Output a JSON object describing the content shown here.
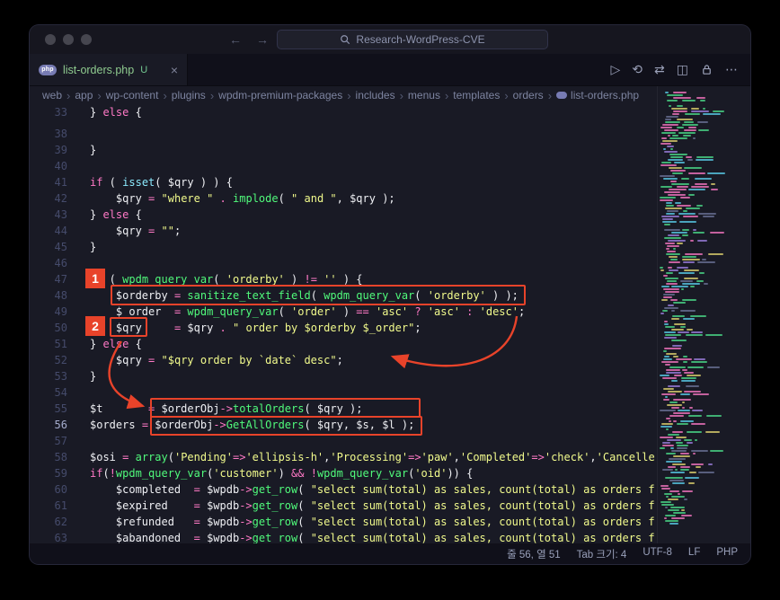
{
  "colors": {
    "accent_red": "#e8432a",
    "php_badge": "#777bb3",
    "keyword": "#ff79c6",
    "function": "#50fa7b",
    "string": "#f1fa8c",
    "builtin": "#8be9fd"
  },
  "title_bar": {
    "search_text": "Research-WordPress-CVE",
    "back_arrow": "←",
    "forward_arrow": "→"
  },
  "icons": {
    "run": "▷",
    "history": "⟲",
    "changes": "⇄",
    "split_editor": "◫",
    "more": "⋯"
  },
  "tab": {
    "file_name": "list-orders.php",
    "git_status": "U",
    "close_glyph": "×",
    "php_icon_label": "php"
  },
  "breadcrumb": {
    "separator": "›",
    "items": [
      "web",
      "app",
      "wp-content",
      "plugins",
      "wpdm-premium-packages",
      "includes",
      "menus",
      "templates",
      "orders",
      "list-orders.php"
    ]
  },
  "annotations": {
    "badge1": "1",
    "badge2": "2"
  },
  "editor": {
    "active_line": 56,
    "fold_gap_after_line": 33,
    "lines": [
      {
        "n": 33,
        "t": [
          [
            "} ",
            "fg"
          ],
          [
            "else",
            "kw"
          ],
          [
            " {",
            "fg"
          ]
        ]
      },
      {
        "n": 38,
        "t": []
      },
      {
        "n": 39,
        "t": [
          [
            "}",
            "fg"
          ]
        ]
      },
      {
        "n": 40,
        "t": []
      },
      {
        "n": 41,
        "t": [
          [
            "if",
            "kw"
          ],
          [
            " ( ",
            "fg"
          ],
          [
            "isset",
            "bi"
          ],
          [
            "( ",
            "fg"
          ],
          [
            "$qry",
            "vr"
          ],
          [
            " ) ) {",
            "fg"
          ]
        ]
      },
      {
        "n": 42,
        "t": [
          [
            "    ",
            "fg"
          ],
          [
            "$qry",
            "vr"
          ],
          [
            " ",
            "fg"
          ],
          [
            "=",
            "op"
          ],
          [
            " ",
            "fg"
          ],
          [
            "\"where \"",
            "st"
          ],
          [
            " ",
            "fg"
          ],
          [
            ".",
            "op"
          ],
          [
            " ",
            "fg"
          ],
          [
            "implode",
            "fn"
          ],
          [
            "( ",
            "fg"
          ],
          [
            "\" and \"",
            "st"
          ],
          [
            ", ",
            "fg"
          ],
          [
            "$qry",
            "vr"
          ],
          [
            " );",
            "fg"
          ]
        ]
      },
      {
        "n": 43,
        "t": [
          [
            "} ",
            "fg"
          ],
          [
            "else",
            "kw"
          ],
          [
            " {",
            "fg"
          ]
        ]
      },
      {
        "n": 44,
        "t": [
          [
            "    ",
            "fg"
          ],
          [
            "$qry",
            "vr"
          ],
          [
            " ",
            "fg"
          ],
          [
            "=",
            "op"
          ],
          [
            " ",
            "fg"
          ],
          [
            "\"\"",
            "st"
          ],
          [
            ";",
            "fg"
          ]
        ]
      },
      {
        "n": 45,
        "t": [
          [
            "}",
            "fg"
          ]
        ]
      },
      {
        "n": 46,
        "t": []
      },
      {
        "n": 47,
        "t": [
          [
            "if",
            "kw"
          ],
          [
            " ( ",
            "fg"
          ],
          [
            "wpdm_query_var",
            "fn"
          ],
          [
            "( ",
            "fg"
          ],
          [
            "'orderby'",
            "st"
          ],
          [
            " ) ",
            "fg"
          ],
          [
            "!=",
            "op"
          ],
          [
            " ",
            "fg"
          ],
          [
            "''",
            "st"
          ],
          [
            " ) {",
            "fg"
          ]
        ]
      },
      {
        "n": 48,
        "t": [
          [
            "    ",
            "fg"
          ],
          [
            "$orderby",
            "vr"
          ],
          [
            " ",
            "fg"
          ],
          [
            "=",
            "op"
          ],
          [
            " ",
            "fg"
          ],
          [
            "sanitize_text_field",
            "fn"
          ],
          [
            "( ",
            "fg"
          ],
          [
            "wpdm_query_var",
            "fn"
          ],
          [
            "( ",
            "fg"
          ],
          [
            "'orderby'",
            "st"
          ],
          [
            " ) );",
            "fg"
          ]
        ]
      },
      {
        "n": 49,
        "t": [
          [
            "    ",
            "fg"
          ],
          [
            "$_order",
            "vr"
          ],
          [
            "  ",
            "fg"
          ],
          [
            "=",
            "op"
          ],
          [
            " ",
            "fg"
          ],
          [
            "wpdm_query_var",
            "fn"
          ],
          [
            "( ",
            "fg"
          ],
          [
            "'order'",
            "st"
          ],
          [
            " ) ",
            "fg"
          ],
          [
            "==",
            "op"
          ],
          [
            " ",
            "fg"
          ],
          [
            "'asc'",
            "st"
          ],
          [
            " ",
            "fg"
          ],
          [
            "?",
            "op"
          ],
          [
            " ",
            "fg"
          ],
          [
            "'asc'",
            "st"
          ],
          [
            " ",
            "fg"
          ],
          [
            ":",
            "op"
          ],
          [
            " ",
            "fg"
          ],
          [
            "'desc'",
            "st"
          ],
          [
            ";",
            "fg"
          ]
        ]
      },
      {
        "n": 50,
        "t": [
          [
            "    ",
            "fg"
          ],
          [
            "$qry",
            "vr"
          ],
          [
            "     ",
            "fg"
          ],
          [
            "=",
            "op"
          ],
          [
            " ",
            "fg"
          ],
          [
            "$qry",
            "vr"
          ],
          [
            " ",
            "fg"
          ],
          [
            ".",
            "op"
          ],
          [
            " ",
            "fg"
          ],
          [
            "\" order by $orderby $_order\"",
            "st"
          ],
          [
            ";",
            "fg"
          ]
        ]
      },
      {
        "n": 51,
        "t": [
          [
            "} ",
            "fg"
          ],
          [
            "else",
            "kw"
          ],
          [
            " {",
            "fg"
          ]
        ]
      },
      {
        "n": 52,
        "t": [
          [
            "    ",
            "fg"
          ],
          [
            "$qry",
            "vr"
          ],
          [
            " ",
            "fg"
          ],
          [
            "=",
            "op"
          ],
          [
            " ",
            "fg"
          ],
          [
            "\"$qry order by `date` desc\"",
            "st"
          ],
          [
            ";",
            "fg"
          ]
        ]
      },
      {
        "n": 53,
        "t": [
          [
            "}",
            "fg"
          ]
        ]
      },
      {
        "n": 54,
        "t": []
      },
      {
        "n": 55,
        "t": [
          [
            "$t",
            "vr"
          ],
          [
            "       ",
            "fg"
          ],
          [
            "=",
            "op"
          ],
          [
            " ",
            "fg"
          ],
          [
            "$orderObj",
            "vr"
          ],
          [
            "->",
            "op"
          ],
          [
            "totalOrders",
            "fn"
          ],
          [
            "( ",
            "fg"
          ],
          [
            "$qry",
            "vr"
          ],
          [
            " );",
            "fg"
          ]
        ]
      },
      {
        "n": 56,
        "t": [
          [
            "$orders",
            "vr"
          ],
          [
            " ",
            "fg"
          ],
          [
            "=",
            "op"
          ],
          [
            " ",
            "fg"
          ],
          [
            "$orderObj",
            "vr"
          ],
          [
            "->",
            "op"
          ],
          [
            "GetAllOrders",
            "fn"
          ],
          [
            "( ",
            "fg"
          ],
          [
            "$qry",
            "vr"
          ],
          [
            ", ",
            "fg"
          ],
          [
            "$s",
            "vr"
          ],
          [
            ", ",
            "fg"
          ],
          [
            "$l",
            "vr"
          ],
          [
            " );",
            "fg"
          ]
        ]
      },
      {
        "n": 57,
        "t": []
      },
      {
        "n": 58,
        "t": [
          [
            "$osi",
            "vr"
          ],
          [
            " ",
            "fg"
          ],
          [
            "=",
            "op"
          ],
          [
            " ",
            "fg"
          ],
          [
            "array",
            "fn"
          ],
          [
            "(",
            "fg"
          ],
          [
            "'Pending'",
            "st"
          ],
          [
            "=>",
            "op"
          ],
          [
            "'ellipsis-h'",
            "st"
          ],
          [
            ",",
            "fg"
          ],
          [
            "'Processing'",
            "st"
          ],
          [
            "=>",
            "op"
          ],
          [
            "'paw'",
            "st"
          ],
          [
            ",",
            "fg"
          ],
          [
            "'Completed'",
            "st"
          ],
          [
            "=>",
            "op"
          ],
          [
            "'check'",
            "st"
          ],
          [
            ",",
            "fg"
          ],
          [
            "'Cancelle",
            "st"
          ]
        ]
      },
      {
        "n": 59,
        "t": [
          [
            "if",
            "kw"
          ],
          [
            "(",
            "fg"
          ],
          [
            "!",
            "op"
          ],
          [
            "wpdm_query_var",
            "fn"
          ],
          [
            "(",
            "fg"
          ],
          [
            "'customer'",
            "st"
          ],
          [
            ") ",
            "fg"
          ],
          [
            "&&",
            "op"
          ],
          [
            " ",
            "fg"
          ],
          [
            "!",
            "op"
          ],
          [
            "wpdm_query_var",
            "fn"
          ],
          [
            "(",
            "fg"
          ],
          [
            "'oid'",
            "st"
          ],
          [
            ")) {",
            "fg"
          ]
        ]
      },
      {
        "n": 60,
        "t": [
          [
            "    ",
            "fg"
          ],
          [
            "$completed",
            "vr"
          ],
          [
            "  ",
            "fg"
          ],
          [
            "=",
            "op"
          ],
          [
            " ",
            "fg"
          ],
          [
            "$wpdb",
            "vr"
          ],
          [
            "->",
            "op"
          ],
          [
            "get_row",
            "fn"
          ],
          [
            "( ",
            "fg"
          ],
          [
            "\"select sum(total) as sales, count(total) as orders f",
            "st"
          ]
        ]
      },
      {
        "n": 61,
        "t": [
          [
            "    ",
            "fg"
          ],
          [
            "$expired",
            "vr"
          ],
          [
            "    ",
            "fg"
          ],
          [
            "=",
            "op"
          ],
          [
            " ",
            "fg"
          ],
          [
            "$wpdb",
            "vr"
          ],
          [
            "->",
            "op"
          ],
          [
            "get_row",
            "fn"
          ],
          [
            "( ",
            "fg"
          ],
          [
            "\"select sum(total) as sales, count(total) as orders f",
            "st"
          ]
        ]
      },
      {
        "n": 62,
        "t": [
          [
            "    ",
            "fg"
          ],
          [
            "$refunded",
            "vr"
          ],
          [
            "   ",
            "fg"
          ],
          [
            "=",
            "op"
          ],
          [
            " ",
            "fg"
          ],
          [
            "$wpdb",
            "vr"
          ],
          [
            "->",
            "op"
          ],
          [
            "get_row",
            "fn"
          ],
          [
            "( ",
            "fg"
          ],
          [
            "\"select sum(total) as sales, count(total) as orders f",
            "st"
          ]
        ]
      },
      {
        "n": 63,
        "t": [
          [
            "    ",
            "fg"
          ],
          [
            "$abandoned",
            "vr"
          ],
          [
            "  ",
            "fg"
          ],
          [
            "=",
            "op"
          ],
          [
            " ",
            "fg"
          ],
          [
            "$wpdb",
            "vr"
          ],
          [
            "->",
            "op"
          ],
          [
            "get_row",
            "fn"
          ],
          [
            "( ",
            "fg"
          ],
          [
            "\"select sum(total) as sales, count(total) as orders f",
            "st"
          ]
        ]
      }
    ]
  },
  "status_bar": {
    "items": [
      "줄 56, 열 51",
      "Tab 크기: 4",
      "UTF-8",
      "LF",
      "PHP"
    ]
  }
}
